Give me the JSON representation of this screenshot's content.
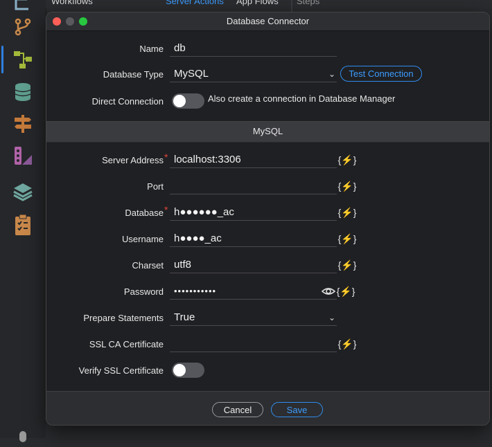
{
  "background": {
    "tabs": [
      "Workflows",
      "Server Actions",
      "App Flows",
      "Steps"
    ]
  },
  "dialog": {
    "title": "Database Connector",
    "name_label": "Name",
    "name_value": "db",
    "db_type_label": "Database Type",
    "db_type_value": "MySQL",
    "test_button": "Test Connection",
    "direct_label": "Direct Connection",
    "direct_desc": "Also create a connection in Database Manager",
    "section_title": "MySQL",
    "server_label": "Server Address",
    "server_value": "localhost:3306",
    "port_label": "Port",
    "port_value": "",
    "database_label": "Database",
    "database_value": "h●●●●●●_ac",
    "username_label": "Username",
    "username_value": "h●●●●_ac",
    "charset_label": "Charset",
    "charset_value": "utf8",
    "password_label": "Password",
    "password_value": "•••••••••••",
    "prepare_label": "Prepare Statements",
    "prepare_value": "True",
    "ssl_ca_label": "SSL CA Certificate",
    "ssl_ca_value": "",
    "verify_ssl_label": "Verify SSL Certificate",
    "required_mark": "*",
    "dynamic_symbol": "{⚡}",
    "cancel": "Cancel",
    "save": "Save",
    "direct_connection_on": false,
    "verify_ssl_on": false
  },
  "colors": {
    "accent": "#2f8df0",
    "required": "#e0453a",
    "traffic_close": "#ff5f57",
    "traffic_min": "#5a5a5e",
    "traffic_max": "#28c840"
  }
}
